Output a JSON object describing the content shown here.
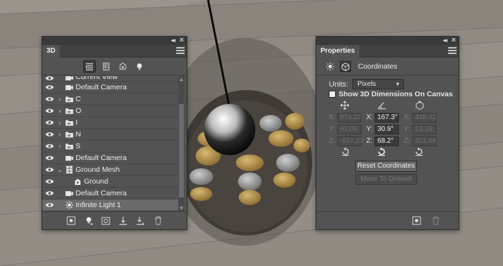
{
  "panel_3d": {
    "tab_label": "3D",
    "filters": [
      {
        "icon": "scene-filter-icon",
        "active": true
      },
      {
        "icon": "mesh-filter-icon",
        "active": false
      },
      {
        "icon": "materials-filter-icon",
        "active": false
      },
      {
        "icon": "lights-filter-icon",
        "active": false
      }
    ],
    "layers": [
      {
        "name": "Current View",
        "icon": "camera-icon",
        "partial": true
      },
      {
        "name": "Default Camera",
        "icon": "camera-icon"
      },
      {
        "name": "C",
        "icon": "folder-icon",
        "expandable": true
      },
      {
        "name": "O",
        "icon": "folder-icon",
        "expandable": true
      },
      {
        "name": "I",
        "icon": "folder-icon",
        "expandable": true
      },
      {
        "name": "N",
        "icon": "folder-icon",
        "expandable": true
      },
      {
        "name": "S",
        "icon": "folder-icon",
        "expandable": true
      },
      {
        "name": "Default Camera",
        "icon": "camera-icon"
      },
      {
        "name": "Ground Mesh",
        "icon": "mesh-icon",
        "expanded": true
      },
      {
        "name": "Ground",
        "icon": "material-icon",
        "indent": true
      },
      {
        "name": "Default Camera",
        "icon": "camera-icon"
      },
      {
        "name": "Infinite Light 1",
        "icon": "light-icon",
        "selected": true
      }
    ],
    "footer_icons": [
      "render-icon",
      "new-light-icon",
      "add-constraint-icon",
      "drop-to-ground-icon",
      "move-to-ground-icon",
      "delete-icon"
    ]
  },
  "panel_props": {
    "tab_label": "Properties",
    "section_title": "Coordinates",
    "units_label": "Units:",
    "units_value": "Pixels",
    "show_dimensions_label": "Show 3D Dimensions On Canvas",
    "axis_labels": [
      "X:",
      "Y:",
      "Z:"
    ],
    "position": {
      "x": "874.22",
      "y": "63.09",
      "z": "-527.23"
    },
    "rotation": {
      "x": "167.3°",
      "y": "30.9°",
      "z": "68.2°"
    },
    "scale": {
      "x": "448.42",
      "y": "13.18",
      "z": "321.64"
    },
    "reset_coordinates_label": "Reset Coordinates",
    "move_to_ground_label": "Move To Ground"
  },
  "colors": {
    "panel_bg": "#535353",
    "panel_dark": "#3a3a3a",
    "wood": "#8f8982",
    "selected_row": "#6a6a6a"
  }
}
